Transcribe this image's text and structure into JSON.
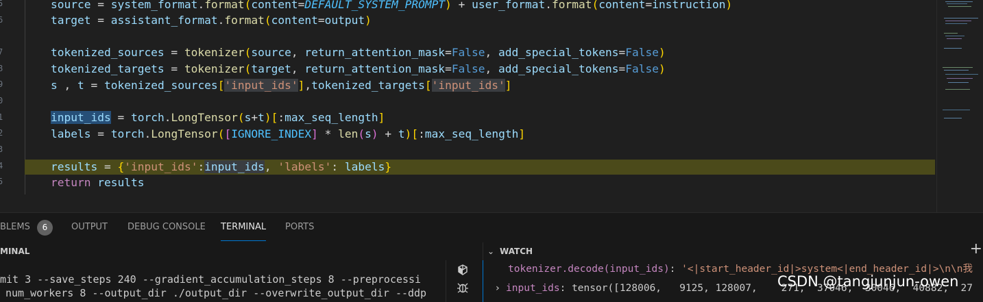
{
  "editor": {
    "line_numbers": [
      "5",
      "6",
      "",
      "7",
      "8",
      "9",
      "0",
      "1",
      "2",
      "3",
      "4",
      "5",
      "6"
    ],
    "lines": {
      "l1": {
        "a": "source",
        "b": " = ",
        "c": "system_format",
        "d": ".",
        "e": "format",
        "f": "(",
        "g": "content",
        "h": "=",
        "i": "DEFAULT_SYSTEM_PROMPT",
        "j": ")",
        "k": " + ",
        "l": "user_format",
        "m": ".",
        "n": "format",
        "o": "(",
        "p": "content",
        "q": "=",
        "r": "instruction",
        "s": ")"
      },
      "l2": {
        "a": "target",
        "b": " = ",
        "c": "assistant_format",
        "d": ".",
        "e": "format",
        "f": "(",
        "g": "content",
        "h": "=",
        "i": "output",
        "j": ")"
      },
      "l3": {
        "a": "tokenized_sources",
        "b": " = ",
        "c": "tokenizer",
        "d": "(",
        "e": "source",
        "f": ", ",
        "g": "return_attention_mask",
        "h": "=",
        "i": "False",
        "j": ", ",
        "k": "add_special_tokens",
        "l": "=",
        "m": "False",
        "n": ")"
      },
      "l4": {
        "a": "tokenized_targets",
        "b": " = ",
        "c": "tokenizer",
        "d": "(",
        "e": "target",
        "f": ", ",
        "g": "return_attention_mask",
        "h": "=",
        "i": "False",
        "j": ", ",
        "k": "add_special_tokens",
        "l": "=",
        "m": "False",
        "n": ")"
      },
      "l5": {
        "a": "s",
        "b": " , ",
        "c": "t",
        "d": " = ",
        "e": "tokenized_sources",
        "f": "[",
        "g": "'input_ids'",
        "h": "]",
        "i": ",",
        "j": "tokenized_targets",
        "k": "[",
        "l": "'input_ids'",
        "m": "]"
      },
      "l6": {
        "a": "input_ids",
        "b": " = ",
        "c": "torch",
        "d": ".",
        "e": "LongTensor",
        "f": "(",
        "g": "s",
        "h": "+",
        "i": "t",
        "j": ")",
        "k": "[",
        "l": ":",
        "m": "max_seq_length",
        "n": "]"
      },
      "l7": {
        "a": "labels",
        "b": " = ",
        "c": "torch",
        "d": ".",
        "e": "LongTensor",
        "f": "(",
        "g": "[",
        "h": "IGNORE_INDEX",
        "i": "]",
        "j": " * ",
        "k": "len",
        "l": "(",
        "m": "s",
        "n": ")",
        "o": " + ",
        "p": "t",
        "q": ")",
        "r": "[",
        "s": ":",
        "t": "max_seq_length",
        "u": "]"
      },
      "l8": {
        "a": "results",
        "b": " = ",
        "c": "{",
        "d": "'input_ids'",
        "e": ":",
        "f": "input_ids",
        "g": ", ",
        "h": "'labels'",
        "i": ": ",
        "j": "labels",
        "k": "}"
      },
      "l9": {
        "a": "return",
        "b": " ",
        "c": "results"
      }
    }
  },
  "panel": {
    "tabs": {
      "problems": "BLEMS",
      "output": "OUTPUT",
      "debug_console": "DEBUG CONSOLE",
      "terminal": "TERMINAL",
      "ports": "PORTS"
    },
    "problems_count": "6",
    "terminal_title": "MINAL",
    "terminal_lines": [
      "mit 3 --save_steps 240 --gradient_accumulation_steps 8 --preprocessi",
      "num_workers 8 --output_dir ./output_dir --overwrite_output_dir --ddp"
    ]
  },
  "watch": {
    "title": "WATCH",
    "add_symbol": "+",
    "rows": [
      {
        "name": "tokenizer.decode(input_ids)",
        "sep": ": ",
        "value": "'<|start_header_id|>system<|end_header_id|>\\n\\n我"
      },
      {
        "name": "input_ids",
        "sep": ": ",
        "value": "tensor([128006,   9125, 128007,    271,  37046,  30046,  40882,  27"
      }
    ]
  },
  "watermark": "CSDN @tangjunjun-owen",
  "colors": {
    "accent": "#0078d4",
    "highlight_line": "#4b4a1a",
    "selection": "#264f78"
  }
}
